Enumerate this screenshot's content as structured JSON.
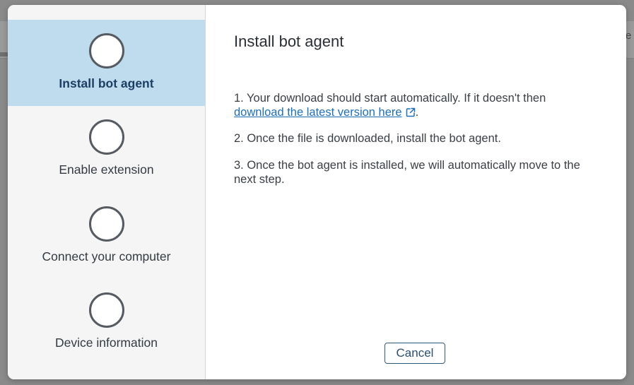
{
  "backdrop": {
    "edge_letter": "e"
  },
  "steps": [
    {
      "label": "Install bot agent",
      "active": true
    },
    {
      "label": "Enable extension",
      "active": false
    },
    {
      "label": "Connect your computer",
      "active": false
    },
    {
      "label": "Device information",
      "active": false
    }
  ],
  "content": {
    "title": "Install bot agent",
    "step1_text": "1. Your download should start automatically. If it doesn't then",
    "step1_link": "download the latest version here",
    "step1_end": ".",
    "step2_text": "2. Once the file is downloaded, install the bot agent.",
    "step3_text": "3. Once the bot agent is installed, we will automatically move to the next step.",
    "link_icon": "external-link-icon"
  },
  "footer": {
    "cancel_label": "Cancel"
  },
  "colors": {
    "active_step_bg": "#bfdbee",
    "link": "#1f6fb5",
    "sidebar_bg": "#f5f5f5"
  }
}
